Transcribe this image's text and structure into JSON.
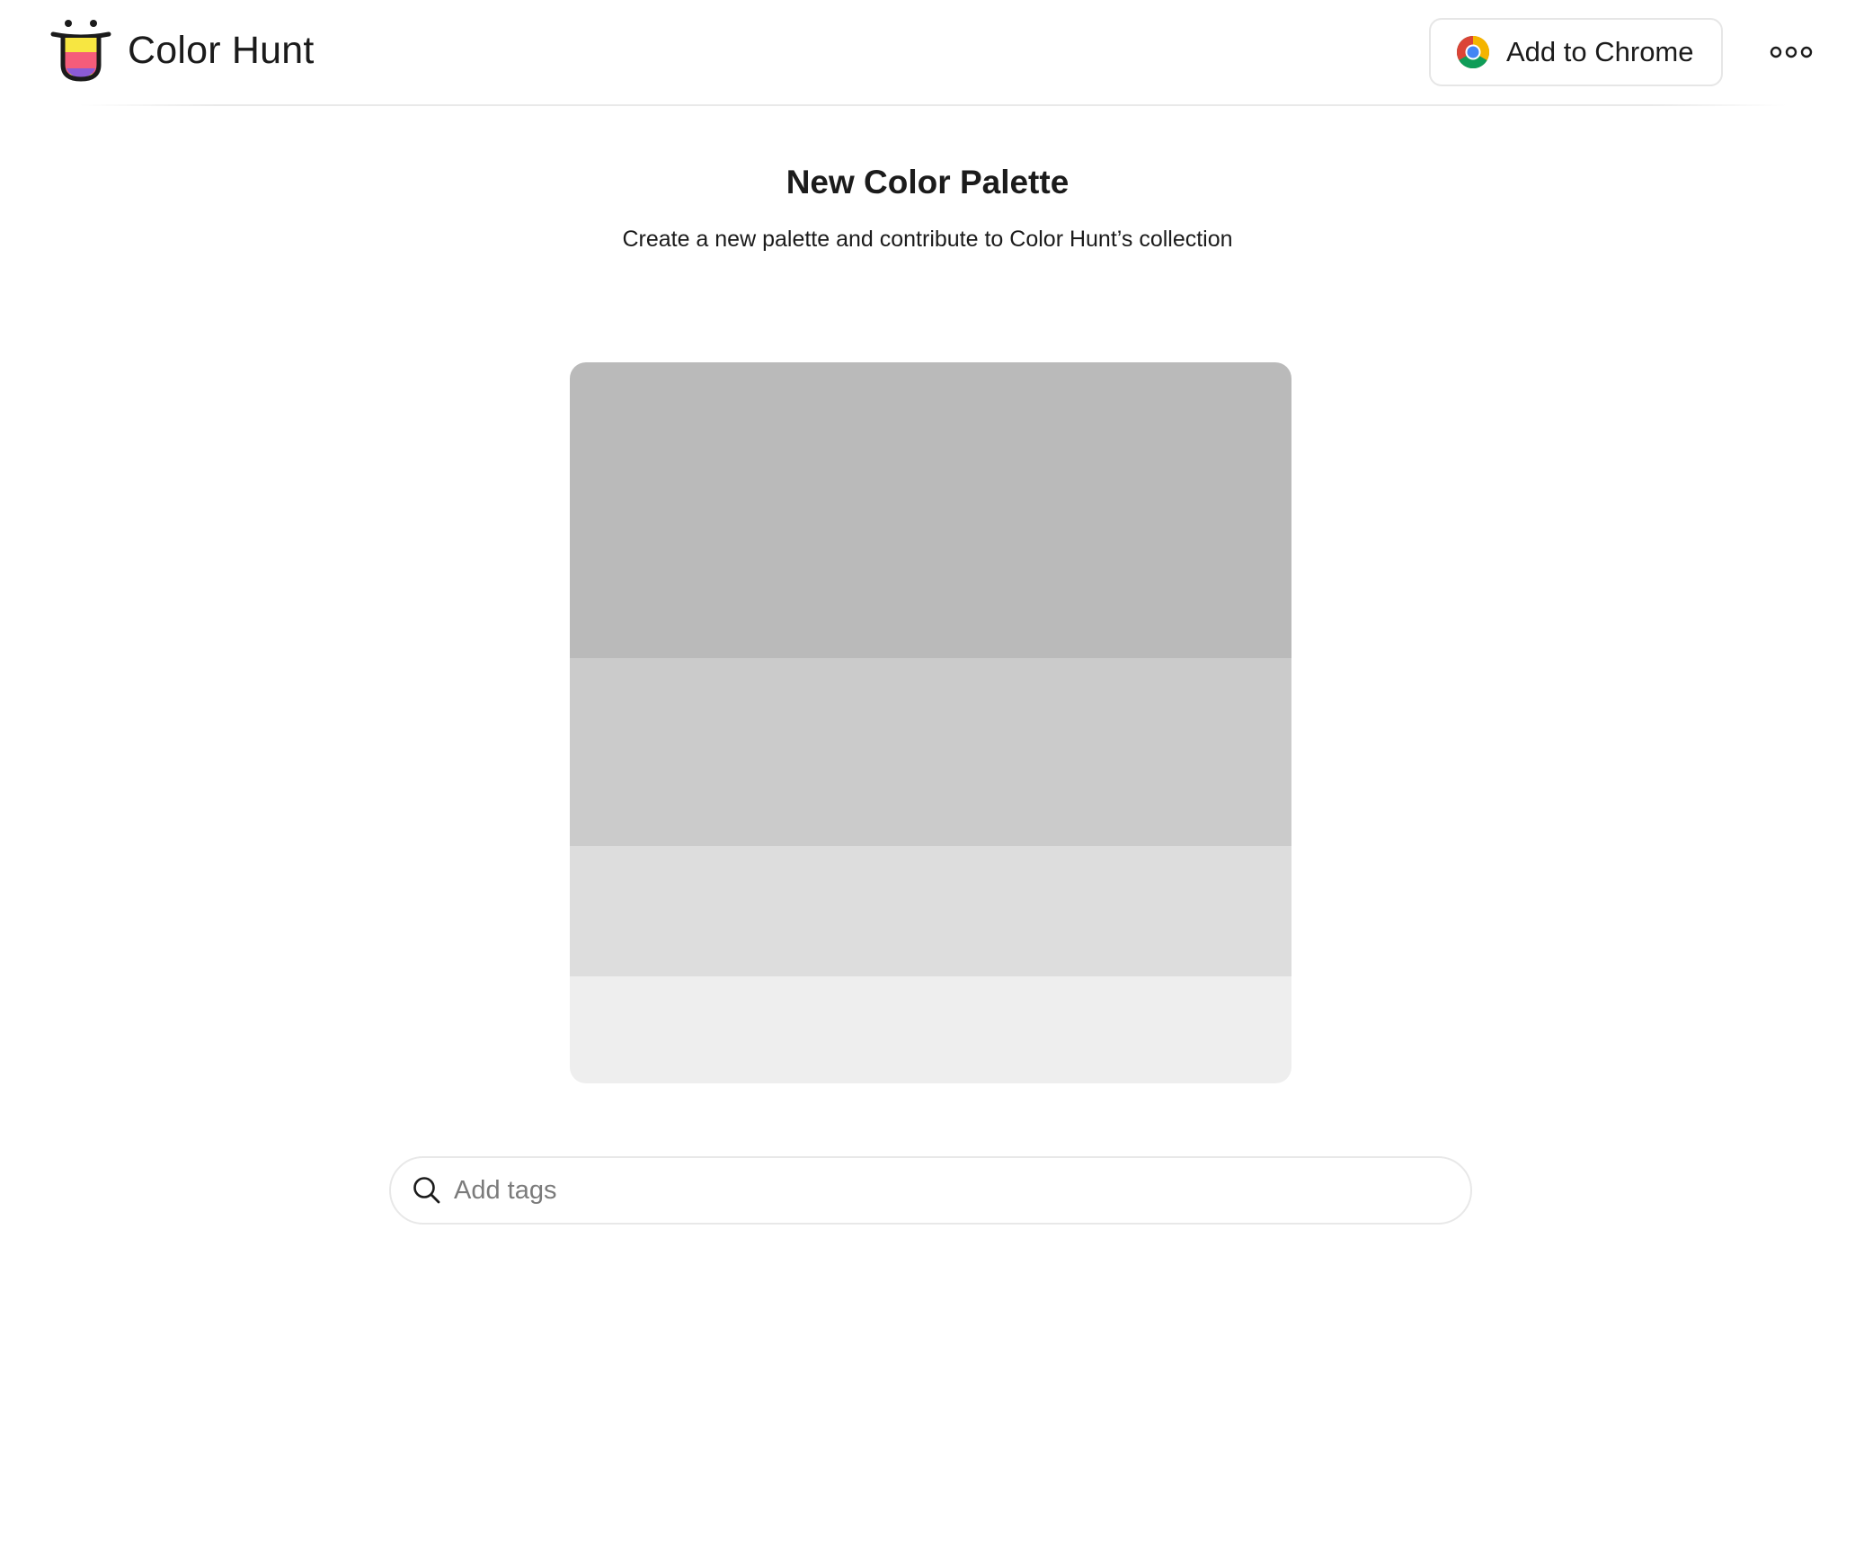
{
  "header": {
    "brand": "Color Hunt",
    "chrome_button_label": "Add to Chrome",
    "logo_icon": "color-hunt-logo-icon",
    "more_icon": "more-icon"
  },
  "main": {
    "title": "New Color Palette",
    "subtitle": "Create a new palette and contribute to Color Hunt’s collection"
  },
  "palette": {
    "swatches": [
      {
        "color": "#bababa"
      },
      {
        "color": "#cbcbcb"
      },
      {
        "color": "#dddddd"
      },
      {
        "color": "#eeeeee"
      }
    ]
  },
  "tags": {
    "placeholder": "Add tags",
    "value": "",
    "icon": "search-icon"
  }
}
